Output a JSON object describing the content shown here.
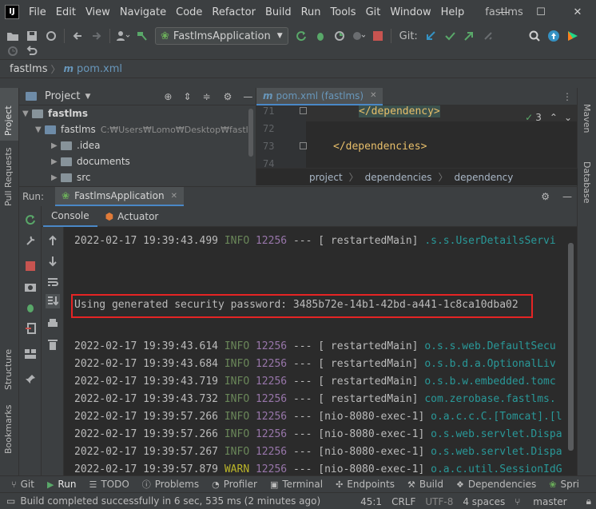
{
  "title_bar": {
    "logo_text": "IJ",
    "menu": [
      "File",
      "Edit",
      "View",
      "Navigate",
      "Code",
      "Refactor",
      "Build",
      "Run",
      "Tools",
      "Git",
      "Window",
      "Help"
    ],
    "project_name": "fastlms"
  },
  "toolbar": {
    "run_config": "FastlmsApplication",
    "git_label": "Git:"
  },
  "navbar": {
    "project": "fastlms",
    "file": "pom.xml"
  },
  "left_stripe": {
    "tabs": [
      "Project",
      "Pull Requests",
      "Structure",
      "Bookmarks"
    ]
  },
  "right_stripe": {
    "tabs": [
      "Maven",
      "Database"
    ]
  },
  "project_panel": {
    "header": "Project",
    "root": "fastlms",
    "module": {
      "name": "fastlms",
      "path": "C:₩Users₩Lomo₩Desktop₩fastlr"
    },
    "children": [
      ".idea",
      "documents",
      "src"
    ]
  },
  "editor": {
    "tab_label": "pom.xml (fastlms)",
    "lines": [
      {
        "num": "71",
        "text": "</dependency>"
      },
      {
        "num": "72",
        "text": ""
      },
      {
        "num": "73",
        "text": "</dependencies>"
      },
      {
        "num": "74",
        "text": ""
      }
    ],
    "inspection_count": "3",
    "breadcrumbs": [
      "project",
      "dependencies",
      "dependency"
    ]
  },
  "run_window": {
    "label": "Run:",
    "tab": "FastlmsApplication",
    "sub_tabs": [
      "Console",
      "Actuator"
    ],
    "log_lines": [
      {
        "ts": "2022-02-17 19:39:43.499",
        "level": "INFO",
        "pid": "12256",
        "sep": "---",
        "thread": "[  restartedMain]",
        "cls": ".s.s.UserDetailsServi"
      },
      {
        "ts": "",
        "level": "",
        "pid": "",
        "sep": "",
        "thread": "",
        "cls": ""
      },
      {
        "ts": "Using generated security password: 3485b72e-14b1-42bd-a441-1c8ca10dba02",
        "level": "",
        "pid": "",
        "sep": "",
        "thread": "",
        "cls": ""
      },
      {
        "ts": "",
        "level": "",
        "pid": "",
        "sep": "",
        "thread": "",
        "cls": ""
      },
      {
        "ts": "2022-02-17 19:39:43.614",
        "level": "INFO",
        "pid": "12256",
        "sep": "---",
        "thread": "[  restartedMain]",
        "cls": "o.s.s.web.DefaultSecu"
      },
      {
        "ts": "2022-02-17 19:39:43.684",
        "level": "INFO",
        "pid": "12256",
        "sep": "---",
        "thread": "[  restartedMain]",
        "cls": "o.s.b.d.a.OptionalLiv"
      },
      {
        "ts": "2022-02-17 19:39:43.719",
        "level": "INFO",
        "pid": "12256",
        "sep": "---",
        "thread": "[  restartedMain]",
        "cls": "o.s.b.w.embedded.tomc"
      },
      {
        "ts": "2022-02-17 19:39:43.732",
        "level": "INFO",
        "pid": "12256",
        "sep": "---",
        "thread": "[  restartedMain]",
        "cls": "com.zerobase.fastlms."
      },
      {
        "ts": "2022-02-17 19:39:57.266",
        "level": "INFO",
        "pid": "12256",
        "sep": "---",
        "thread": "[nio-8080-exec-1]",
        "cls": "o.a.c.c.C.[Tomcat].[l"
      },
      {
        "ts": "2022-02-17 19:39:57.266",
        "level": "INFO",
        "pid": "12256",
        "sep": "---",
        "thread": "[nio-8080-exec-1]",
        "cls": "o.s.web.servlet.Dispa"
      },
      {
        "ts": "2022-02-17 19:39:57.267",
        "level": "INFO",
        "pid": "12256",
        "sep": "---",
        "thread": "[nio-8080-exec-1]",
        "cls": "o.s.web.servlet.Dispa"
      },
      {
        "ts": "2022-02-17 19:39:57.879",
        "level": "WARN",
        "pid": "12256",
        "sep": "---",
        "thread": "[nio-8080-exec-1]",
        "cls": "o.a.c.util.SessionIdG"
      }
    ]
  },
  "tool_strip": {
    "items": [
      "Git",
      "Run",
      "TODO",
      "Problems",
      "Profiler",
      "Terminal",
      "Endpoints",
      "Build",
      "Dependencies",
      "Spri"
    ],
    "active": "Run"
  },
  "status_bar": {
    "message": "Build completed successfully in 6 sec, 535 ms (2 minutes ago)",
    "position": "45:1",
    "line_sep": "CRLF",
    "encoding": "UTF-8",
    "indent": "4 spaces",
    "branch": "master"
  },
  "colors": {
    "accent": "#4a88c7",
    "info": "#6a8759",
    "warn": "#bbb529",
    "pid": "#9876aa",
    "logger": "#299999",
    "highlight_box": "#e52424"
  }
}
